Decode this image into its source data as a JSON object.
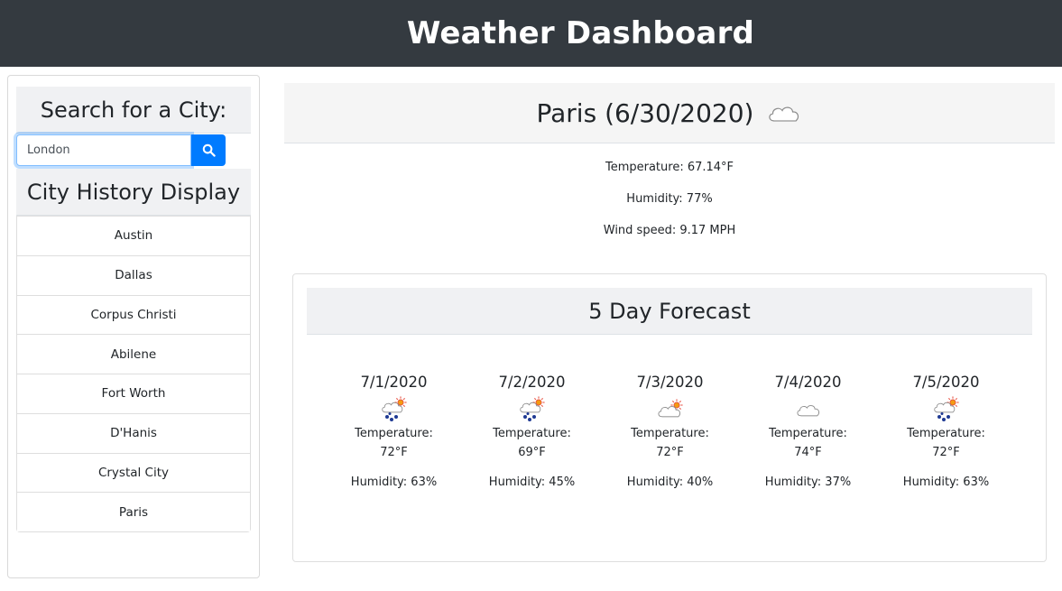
{
  "header": {
    "title": "Weather Dashboard"
  },
  "search": {
    "heading": "Search for a City:",
    "input_value": "London",
    "button_icon": "search-icon"
  },
  "history": {
    "heading": "City History Display",
    "items": [
      "Austin",
      "Dallas",
      "Corpus Christi",
      "Abilene",
      "Fort Worth",
      "D'Hanis",
      "Crystal City",
      "Paris"
    ]
  },
  "current": {
    "title": "Paris (6/30/2020)",
    "icon": "cloud-icon",
    "temperature": "Temperature: 67.14°F",
    "humidity": "Humidity: 77%",
    "wind": "Wind speed: 9.17 MPH"
  },
  "forecast": {
    "heading": "5 Day Forecast",
    "days": [
      {
        "date": "7/1/2020",
        "icon": "rain-sun-icon",
        "temp_label": "Temperature:",
        "temp": "72°F",
        "humidity": "Humidity: 63%"
      },
      {
        "date": "7/2/2020",
        "icon": "rain-sun-icon",
        "temp_label": "Temperature:",
        "temp": "69°F",
        "humidity": "Humidity: 45%"
      },
      {
        "date": "7/3/2020",
        "icon": "cloud-sun-icon",
        "temp_label": "Temperature:",
        "temp": "72°F",
        "humidity": "Humidity: 40%"
      },
      {
        "date": "7/4/2020",
        "icon": "cloud-icon",
        "temp_label": "Temperature:",
        "temp": "74°F",
        "humidity": "Humidity: 37%"
      },
      {
        "date": "7/5/2020",
        "icon": "rain-sun-icon",
        "temp_label": "Temperature:",
        "temp": "72°F",
        "humidity": "Humidity: 63%"
      }
    ]
  },
  "colors": {
    "navbar": "#343a40",
    "accent": "#007bff",
    "header_bg": "#f0f1f3"
  }
}
